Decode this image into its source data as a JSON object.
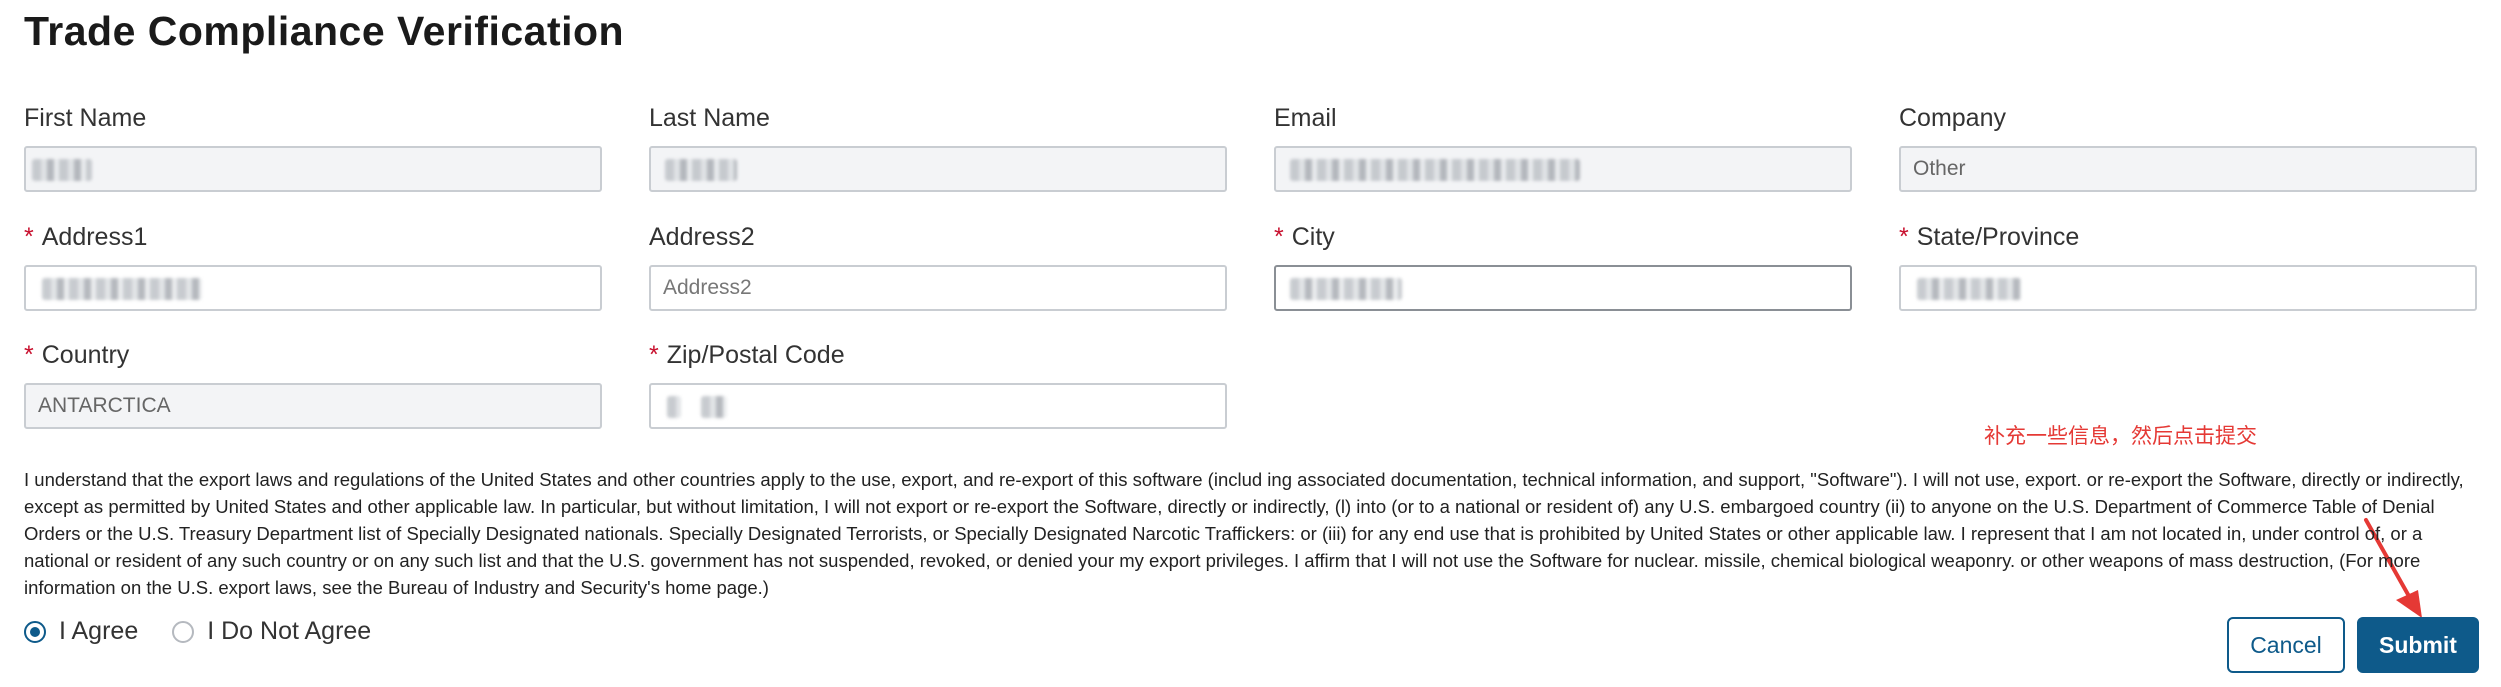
{
  "page": {
    "title": "Trade Compliance Verification"
  },
  "fields": {
    "first_name": {
      "label": "First Name",
      "value": "",
      "required": false
    },
    "last_name": {
      "label": "Last Name",
      "value": "",
      "required": false
    },
    "email": {
      "label": "Email",
      "value": "",
      "required": false
    },
    "company": {
      "label": "Company",
      "value": "Other",
      "required": false
    },
    "address1": {
      "label": "Address1",
      "value": "",
      "required": true
    },
    "address2": {
      "label": "Address2",
      "placeholder": "Address2",
      "required": false
    },
    "city": {
      "label": "City",
      "value": "",
      "required": true
    },
    "state": {
      "label": "State/Province",
      "value": "",
      "required": true
    },
    "country": {
      "label": "Country",
      "value": "ANTARCTICA",
      "required": true
    },
    "zip": {
      "label": "Zip/Postal Code",
      "value": "",
      "required": true
    }
  },
  "required_marker": "*",
  "terms": {
    "text": "I understand that the export laws and regulations of the United States and other countries apply to the use, export, and re-export of this software (includ ing associated documentation, technical information, and support, \"Software\"). I will not use, export. or re-export the Software, directly or indirectly, except as permitted by United States and other applicable law. In particular, but without limitation, I will not export or re-export the Software, directly or indirectly, (l) into (or to a national or resident of) any U.S. embargoed country (ii) to anyone on the U.S. Department of Commerce Table of Denial Orders or the U.S. Treasury Department list of Specially Designated nationals. Specially Designated Terrorists, or Specially Designated Narcotic Traffickers: or (iii) for any end use that is prohibited by United States or other applicable law. I represent that I am not located in, under control of, or a national or resident of any such country or on any such list and that the U.S. government has not suspended, revoked, or denied your my export privileges. I affirm that I will not use the Software for nuclear. missile, chemical biological weaponry. or other weapons of mass destruction, (For more information on the U.S. export laws, see the Bureau of Industry and Security's home page.)"
  },
  "agreement": {
    "agree_label": "I Agree",
    "disagree_label": "I Do Not Agree",
    "selected": "agree"
  },
  "buttons": {
    "cancel": "Cancel",
    "submit": "Submit"
  },
  "annotation": {
    "text": "补充一些信息，然后点击提交",
    "color": "#e53935"
  },
  "colors": {
    "primary": "#0e5a8a",
    "required": "#c8102e",
    "input_disabled_bg": "#f3f4f6"
  },
  "icons": {
    "radio_checked": "radio-checked-icon",
    "radio_unchecked": "radio-unchecked-icon",
    "arrow": "red-arrow-icon"
  }
}
